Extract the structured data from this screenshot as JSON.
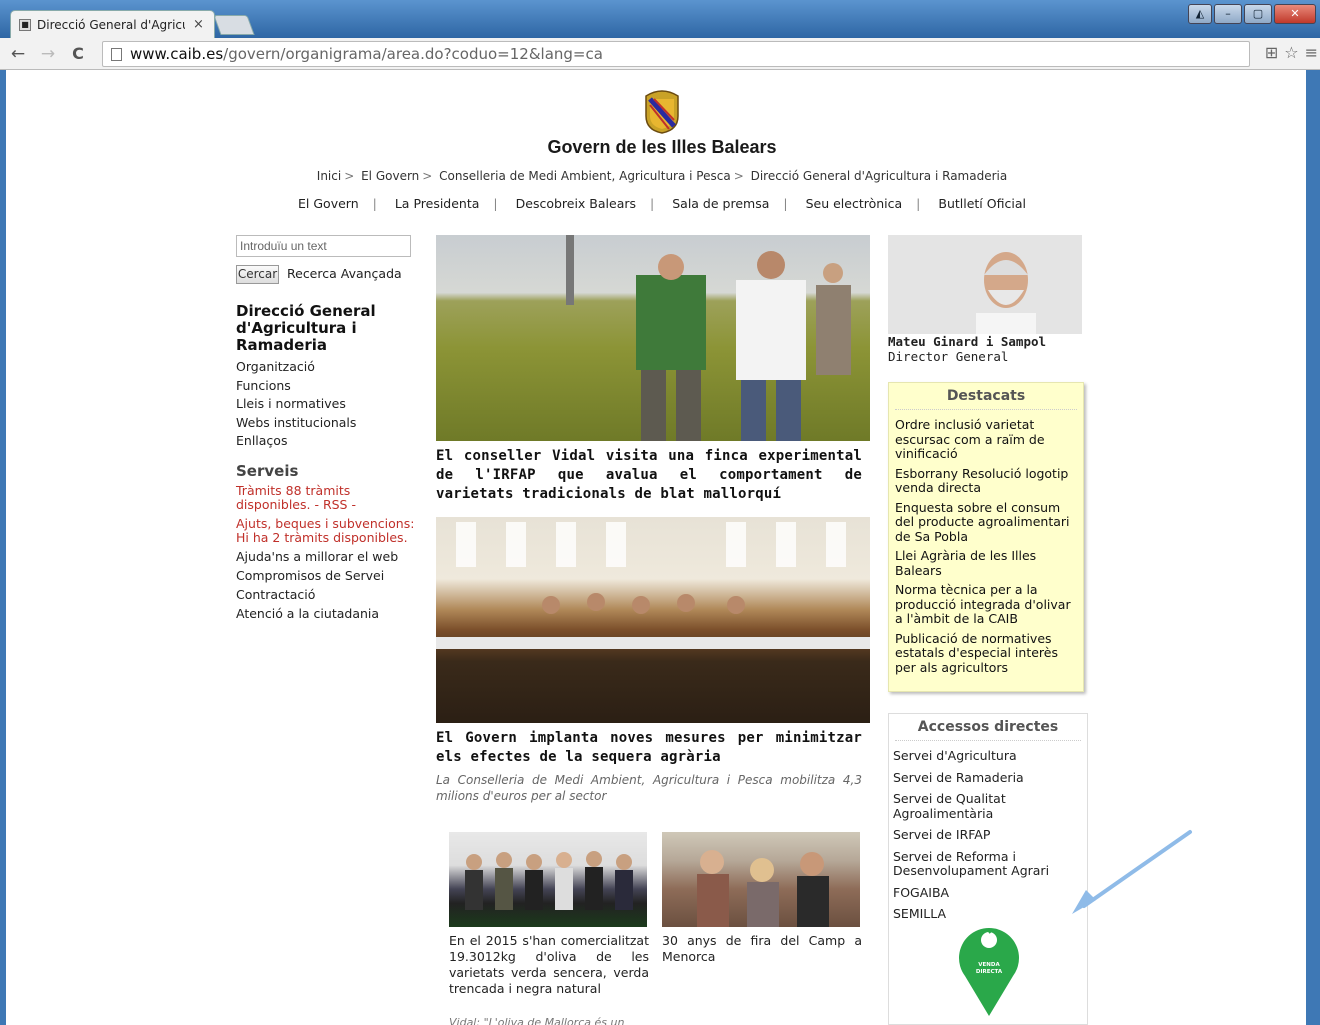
{
  "browser": {
    "tab_title": "Direcció General d'Agricul",
    "tab_close": "×",
    "url_host": "www.caib.es",
    "url_path": "/govern/organigrama/area.do?coduo=12&lang=ca",
    "win_min": "–",
    "win_max": "▢",
    "win_close": "✕",
    "back": "←",
    "forward": "→",
    "reload": "C",
    "translate": "⊞",
    "star": "☆",
    "menu": "≡"
  },
  "header": {
    "site_title": "Govern de les Illes Balears",
    "breadcrumb": [
      "Inici",
      "El Govern",
      "Conselleria de Medi Ambient, Agricultura i Pesca",
      "Direcció General d'Agricultura i Ramaderia"
    ],
    "breadcrumb_sep": ">",
    "topnav": [
      "El Govern",
      "La Presidenta",
      "Descobreix Balears",
      "Sala de premsa",
      "Seu electrònica",
      "Butlletí Oficial"
    ],
    "topnav_sep": "|"
  },
  "search": {
    "placeholder": "Introduïu un text",
    "button": "Cercar",
    "advanced": "Recerca Avançada"
  },
  "left": {
    "org_title": "Direcció General d'Agricultura i Ramaderia",
    "menu": [
      "Organització",
      "Funcions",
      "Lleis i normatives",
      "Webs institucionals",
      "Enllaços"
    ],
    "serveis_title": "Serveis",
    "serveis": [
      "Tràmits 88 tràmits disponibles. - RSS -",
      "Ajuts, beques i subvencions: Hi ha 2 tràmits disponibles.",
      "Ajuda'ns a millorar el web",
      "Compromisos de Servei",
      "Contractació",
      "Atenció a la ciutadania"
    ]
  },
  "news": {
    "headline1": "El conseller Vidal visita una finca experimental de l'IRFAP que avalua el comportament de varietats tradicionals de blat mallorquí",
    "headline2": "El Govern implanta noves mesures per minimitzar els efectes de la sequera agrària",
    "sub2": "La Conselleria de Medi Ambient, Agricultura i Pesca mobilitza 4,3 milions d'euros per al sector",
    "small1": "En el 2015 s'han comercialitzat 19.3012kg d'oliva de les varietats verda sencera, verda trencada i negra natural",
    "small1_sub": "Vidal: \"L'oliva de Mallorca és un",
    "small2": "30 anys de fira del Camp a Menorca"
  },
  "director": {
    "name": "Mateu Ginard i Sampol",
    "role": "Director General"
  },
  "destacats": {
    "title": "Destacats",
    "items": [
      "Ordre inclusió varietat escursac com a raïm de vinificació",
      "Esborrany Resolució logotip venda directa",
      "Enquesta sobre el consum del producte agroalimentari de Sa Pobla",
      "Llei Agrària de les Illes Balears",
      "Norma tècnica per a la producció integrada d'olivar a l'àmbit de la CAIB",
      "Publicació de normatives estatals d'especial interès per als agricultors"
    ]
  },
  "accessos": {
    "title": "Accessos directes",
    "items": [
      "Servei d'Agricultura",
      "Servei de Ramaderia",
      "Servei de Qualitat Agroalimentària",
      "Servei de IRFAP",
      "Servei de Reforma i Desenvolupament Agrari",
      "FOGAIBA",
      "SEMILLA"
    ],
    "logo_text_1": "VENDA",
    "logo_text_2": "DIRECTA"
  },
  "colors": {
    "accent_red": "#c0302a",
    "destacats_bg": "#ffffcc",
    "logo_green": "#2aa84a",
    "arrow_blue": "#8fbbe8"
  }
}
